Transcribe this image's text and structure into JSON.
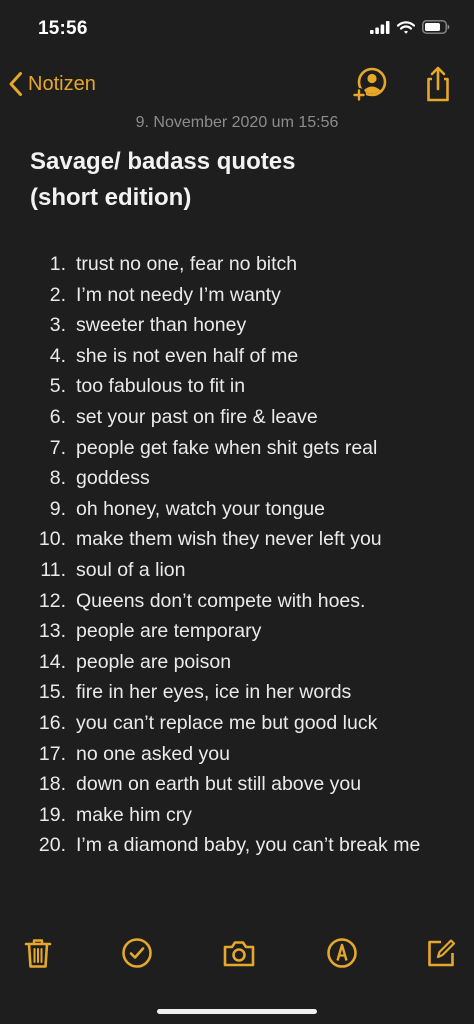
{
  "status_bar": {
    "time": "15:56"
  },
  "nav": {
    "back_label": "Notizen"
  },
  "note": {
    "date": "9. November 2020 um 15:56",
    "title_line1": "Savage/ badass quotes",
    "title_line2": "(short edition)",
    "items": [
      {
        "num": "1.",
        "text": "trust no one, fear no bitch"
      },
      {
        "num": "2.",
        "text": "I’m not needy I’m wanty"
      },
      {
        "num": "3.",
        "text": "sweeter than honey"
      },
      {
        "num": "4.",
        "text": "she is not even half of me"
      },
      {
        "num": "5.",
        "text": "too fabulous to fit in"
      },
      {
        "num": "6.",
        "text": "set your past on fire & leave"
      },
      {
        "num": "7.",
        "text": "people get fake when shit gets real"
      },
      {
        "num": "8.",
        "text": "goddess"
      },
      {
        "num": "9.",
        "text": "oh honey, watch your tongue"
      },
      {
        "num": "10.",
        "text": "make them wish they never left you"
      },
      {
        "num": "11.",
        "text": "soul of a lion"
      },
      {
        "num": "12.",
        "text": "Queens don’t compete with hoes."
      },
      {
        "num": "13.",
        "text": "people are temporary"
      },
      {
        "num": "14.",
        "text": "people are poison"
      },
      {
        "num": "15.",
        "text": "fire in her eyes, ice in her words"
      },
      {
        "num": "16.",
        "text": "you can’t replace me but good luck"
      },
      {
        "num": "17.",
        "text": "no one asked you"
      },
      {
        "num": "18.",
        "text": "down on earth but still above you"
      },
      {
        "num": "19.",
        "text": "make him cry"
      },
      {
        "num": "20.",
        "text": "I’m a diamond baby, you can’t break me"
      }
    ]
  },
  "colors": {
    "background": "#1e1e1e",
    "accent": "#e5a82a",
    "text": "#ececec",
    "secondary_text": "#8d8d8d"
  },
  "icons": {
    "back": "chevron-left-icon",
    "add_people": "add-person-icon",
    "share": "share-icon",
    "delete": "trash-icon",
    "checklist": "checkmark-circle-icon",
    "camera": "camera-icon",
    "markup": "markup-pen-icon",
    "compose": "compose-icon"
  }
}
